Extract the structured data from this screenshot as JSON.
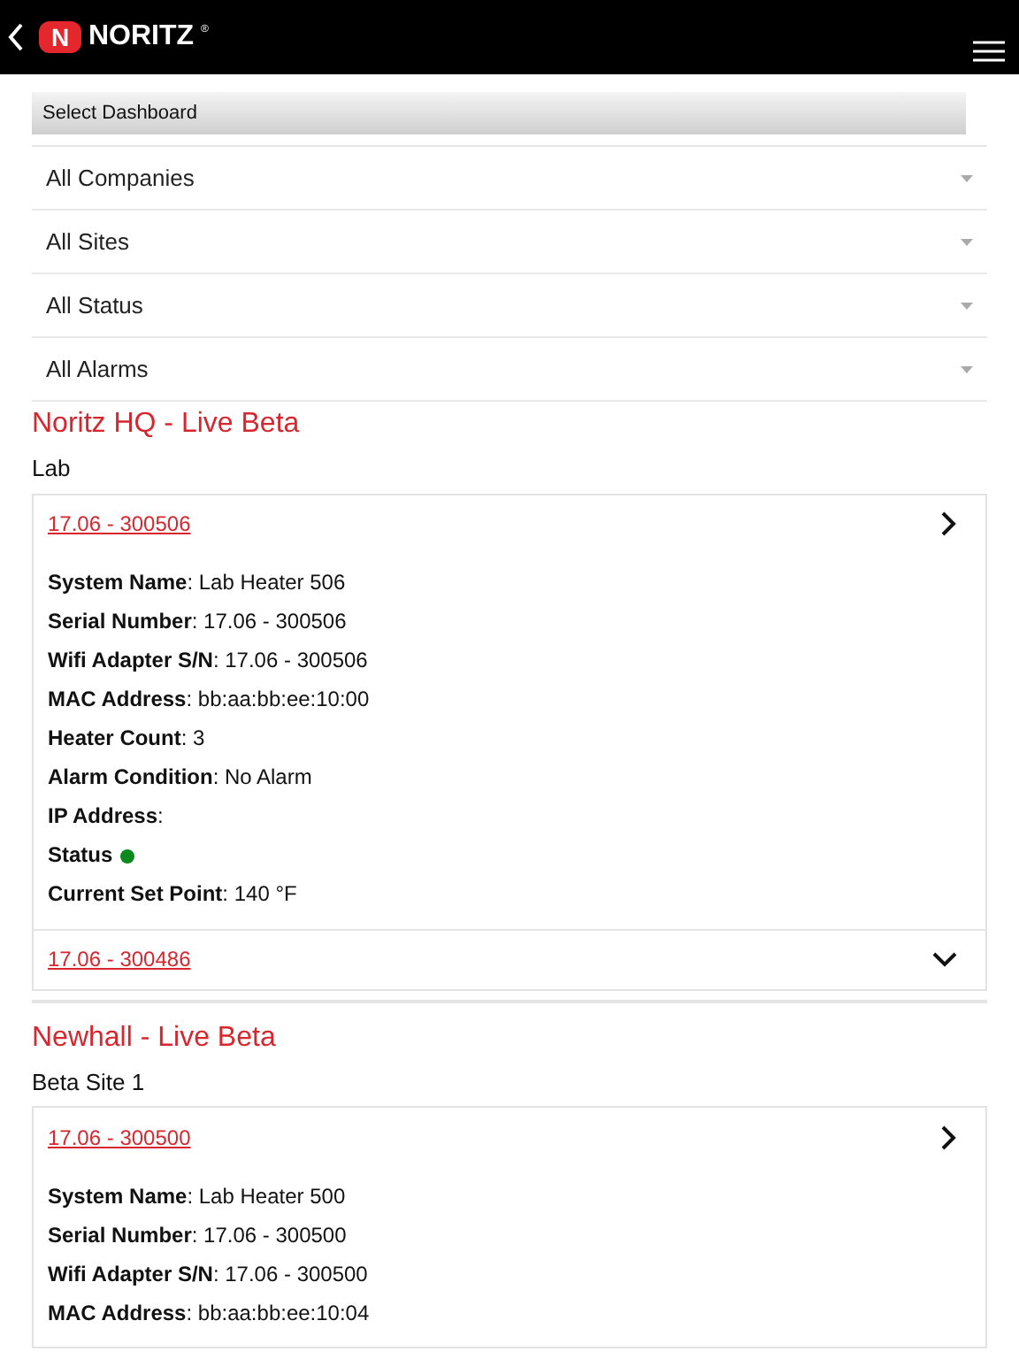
{
  "header": {
    "logo_letter": "N",
    "brand": "NORITZ",
    "registered": "®"
  },
  "dashboard_select": {
    "label": "Select Dashboard"
  },
  "filters": [
    {
      "label": "All Companies"
    },
    {
      "label": "All Sites"
    },
    {
      "label": "All Status"
    },
    {
      "label": "All Alarms"
    }
  ],
  "groups": [
    {
      "title": "Noritz HQ - Live Beta",
      "site": "Lab",
      "devices": [
        {
          "id": "17.06 - 300506",
          "expanded": true,
          "details": [
            {
              "kind": "text",
              "text": "**System Name**: Lab Heater 506"
            },
            {
              "kind": "text",
              "text": "**Serial Number**: 17.06 - 300506"
            },
            {
              "kind": "text",
              "text": "**Wifi Adapter S/N**: 17.06 - 300506"
            },
            {
              "kind": "text",
              "text": "**MAC Address**: bb:aa:bb:ee:10:00"
            },
            {
              "kind": "text",
              "text": "**Heater Count**: 3"
            },
            {
              "kind": "text",
              "text": "**Alarm Condition**: No Alarm"
            },
            {
              "kind": "text",
              "text": "**IP Address**:"
            },
            {
              "kind": "status",
              "text": "Status",
              "color": "#0a8a1e"
            },
            {
              "kind": "text",
              "text": "**Current Set Point**: 140 °F"
            }
          ]
        },
        {
          "id": "17.06 - 300486",
          "expanded": false
        }
      ]
    },
    {
      "title": "Newhall - Live Beta",
      "site": "Beta Site 1",
      "devices": [
        {
          "id": "17.06 - 300500",
          "expanded": true,
          "details": [
            {
              "kind": "text",
              "text": "**System Name**: Lab Heater 500"
            },
            {
              "kind": "text",
              "text": "**Serial Number**: 17.06 - 300500"
            },
            {
              "kind": "text",
              "text": "**Wifi Adapter S/N**: 17.06 - 300500"
            },
            {
              "kind": "text",
              "text": "**MAC Address**: bb:aa:bb:ee:10:04"
            }
          ]
        }
      ]
    }
  ]
}
